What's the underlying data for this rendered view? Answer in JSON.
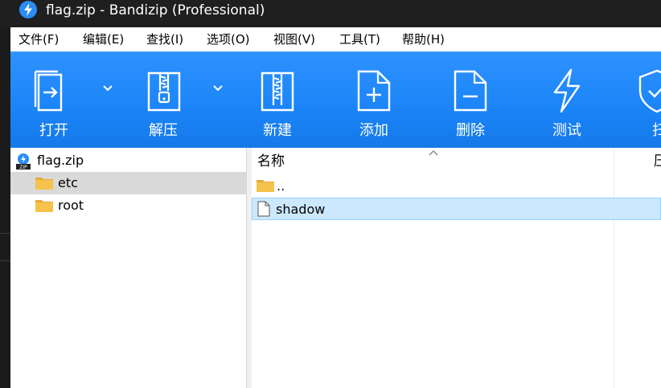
{
  "window": {
    "title": "flag.zip - Bandizip (Professional)"
  },
  "menu": [
    {
      "label": "文件(F)"
    },
    {
      "label": "编辑(E)"
    },
    {
      "label": "查找(I)"
    },
    {
      "label": "选项(O)"
    },
    {
      "label": "视图(V)"
    },
    {
      "label": "工具(T)"
    },
    {
      "label": "帮助(H)"
    }
  ],
  "toolbar": {
    "buttons": [
      {
        "label": "打开",
        "icon": "open-icon",
        "has_dropdown": true
      },
      {
        "label": "解压",
        "icon": "extract-icon",
        "has_dropdown": true
      },
      {
        "label": "新建",
        "icon": "new-archive-icon",
        "has_dropdown": false
      },
      {
        "label": "添加",
        "icon": "add-file-icon",
        "has_dropdown": false
      },
      {
        "label": "删除",
        "icon": "delete-file-icon",
        "has_dropdown": false
      },
      {
        "label": "测试",
        "icon": "test-lightning-icon",
        "has_dropdown": false
      },
      {
        "label": "扫",
        "icon": "scan-shield-icon",
        "has_dropdown": false
      }
    ]
  },
  "tree": {
    "root": {
      "label": "flag.zip",
      "icon": "zip-archive-icon"
    },
    "items": [
      {
        "label": "etc",
        "icon": "folder-icon",
        "selected": true
      },
      {
        "label": "root",
        "icon": "folder-icon",
        "selected": false
      }
    ]
  },
  "list": {
    "columns": [
      {
        "label": "名称"
      },
      {
        "label": "压"
      }
    ],
    "rows": [
      {
        "name": "..",
        "icon": "folder-icon",
        "selected": false
      },
      {
        "name": "shadow",
        "icon": "file-icon",
        "selected": true
      }
    ]
  },
  "colors": {
    "toolbar": "#1a84f7",
    "title_bar": "#1f1f1f",
    "selection": "#cce8ff",
    "tree_selection": "#d9d9d9",
    "folder": "#f5c34b"
  }
}
